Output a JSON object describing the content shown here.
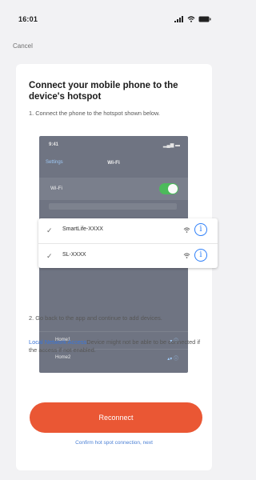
{
  "status_bar": {
    "time": "16:01"
  },
  "nav": {
    "cancel_label": "Cancel"
  },
  "card": {
    "title": "Connect your mobile phone to the device's hotspot",
    "step1": "1. Connect the phone to the hotspot shown below.",
    "illustration": {
      "time": "9:41",
      "back_label": "Settings",
      "wifi_title": "Wi-Fi",
      "wifi_label": "Wi-Fi",
      "toggle_on": true,
      "networks": [
        {
          "name": "SmartLife-XXXX",
          "checked": true
        },
        {
          "name": "SL-XXXX",
          "checked": true
        }
      ],
      "other_networks": [
        {
          "name": "Home1"
        },
        {
          "name": "Home2"
        }
      ]
    },
    "step2": "2. Go back to the app and continue to add devices.",
    "network_link": "Local Network Access",
    "network_note": "Device might not be able to be connected if the access if not enabled.",
    "reconnect_label": "Reconnect",
    "confirm_label": "Confirm hot spot connection, next"
  },
  "colors": {
    "accent": "#ea5734",
    "link": "#3a74d8",
    "background": "#f2f2f4",
    "card": "#ffffff"
  }
}
